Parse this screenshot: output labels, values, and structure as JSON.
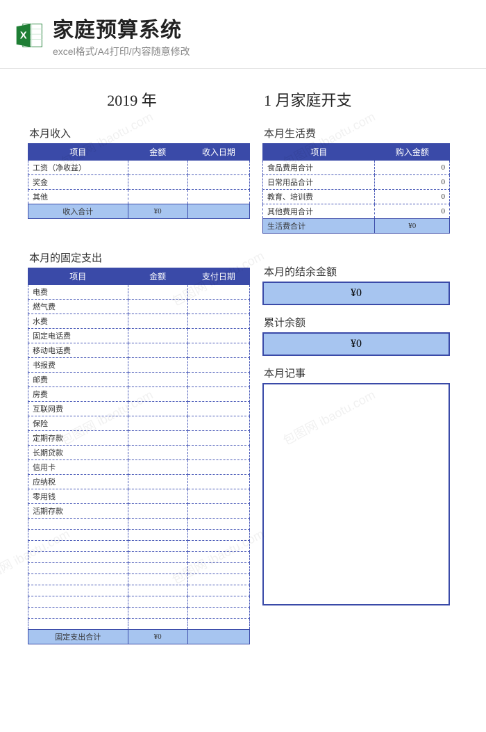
{
  "header": {
    "title": "家庭预算系统",
    "subtitle": "excel格式/A4打印/内容随意修改"
  },
  "title": {
    "year": "2019  年",
    "month": "1 月家庭开支"
  },
  "income": {
    "label": "本月收入",
    "headers": [
      "项目",
      "金额",
      "收入日期"
    ],
    "rows": [
      {
        "item": "工资（净收益）",
        "amount": "",
        "date": ""
      },
      {
        "item": "奖金",
        "amount": "",
        "date": ""
      },
      {
        "item": "其他",
        "amount": "",
        "date": ""
      }
    ],
    "total_label": "收入合计",
    "total_value": "¥0"
  },
  "living": {
    "label": "本月生活费",
    "headers": [
      "项目",
      "购入金额"
    ],
    "rows": [
      {
        "item": "食品费用合计",
        "amount": "0"
      },
      {
        "item": "日常用品合计",
        "amount": "0"
      },
      {
        "item": "教育、培训费",
        "amount": "0"
      },
      {
        "item": "其他费用合计",
        "amount": "0"
      }
    ],
    "total_label": "生活费合计",
    "total_value": "¥0"
  },
  "fixed": {
    "label": "本月的固定支出",
    "headers": [
      "项目",
      "金额",
      "支付日期"
    ],
    "rows": [
      {
        "item": "电费",
        "amount": "",
        "date": ""
      },
      {
        "item": "燃气费",
        "amount": "",
        "date": ""
      },
      {
        "item": "水费",
        "amount": "",
        "date": ""
      },
      {
        "item": "固定电话费",
        "amount": "",
        "date": ""
      },
      {
        "item": "移动电话费",
        "amount": "",
        "date": ""
      },
      {
        "item": "书报费",
        "amount": "",
        "date": ""
      },
      {
        "item": "邮费",
        "amount": "",
        "date": ""
      },
      {
        "item": "房费",
        "amount": "",
        "date": ""
      },
      {
        "item": "互联网费",
        "amount": "",
        "date": ""
      },
      {
        "item": "保险",
        "amount": "",
        "date": ""
      },
      {
        "item": "定期存款",
        "amount": "",
        "date": ""
      },
      {
        "item": "长期贷款",
        "amount": "",
        "date": ""
      },
      {
        "item": "信用卡",
        "amount": "",
        "date": ""
      },
      {
        "item": "应纳税",
        "amount": "",
        "date": ""
      },
      {
        "item": "零用钱",
        "amount": "",
        "date": ""
      },
      {
        "item": "活期存款",
        "amount": "",
        "date": ""
      },
      {
        "item": "",
        "amount": "",
        "date": ""
      },
      {
        "item": "",
        "amount": "",
        "date": ""
      },
      {
        "item": "",
        "amount": "",
        "date": ""
      },
      {
        "item": "",
        "amount": "",
        "date": ""
      },
      {
        "item": "",
        "amount": "",
        "date": ""
      },
      {
        "item": "",
        "amount": "",
        "date": ""
      },
      {
        "item": "",
        "amount": "",
        "date": ""
      },
      {
        "item": "",
        "amount": "",
        "date": ""
      },
      {
        "item": "",
        "amount": "",
        "date": ""
      },
      {
        "item": "",
        "amount": "",
        "date": ""
      }
    ],
    "total_label": "固定支出合计",
    "total_value": "¥0"
  },
  "balance": {
    "label": "本月的结余金额",
    "value": "¥0"
  },
  "accum": {
    "label": "累计余额",
    "value": "¥0"
  },
  "notes": {
    "label": "本月记事"
  },
  "watermark": "包图网 ibaotu.com"
}
